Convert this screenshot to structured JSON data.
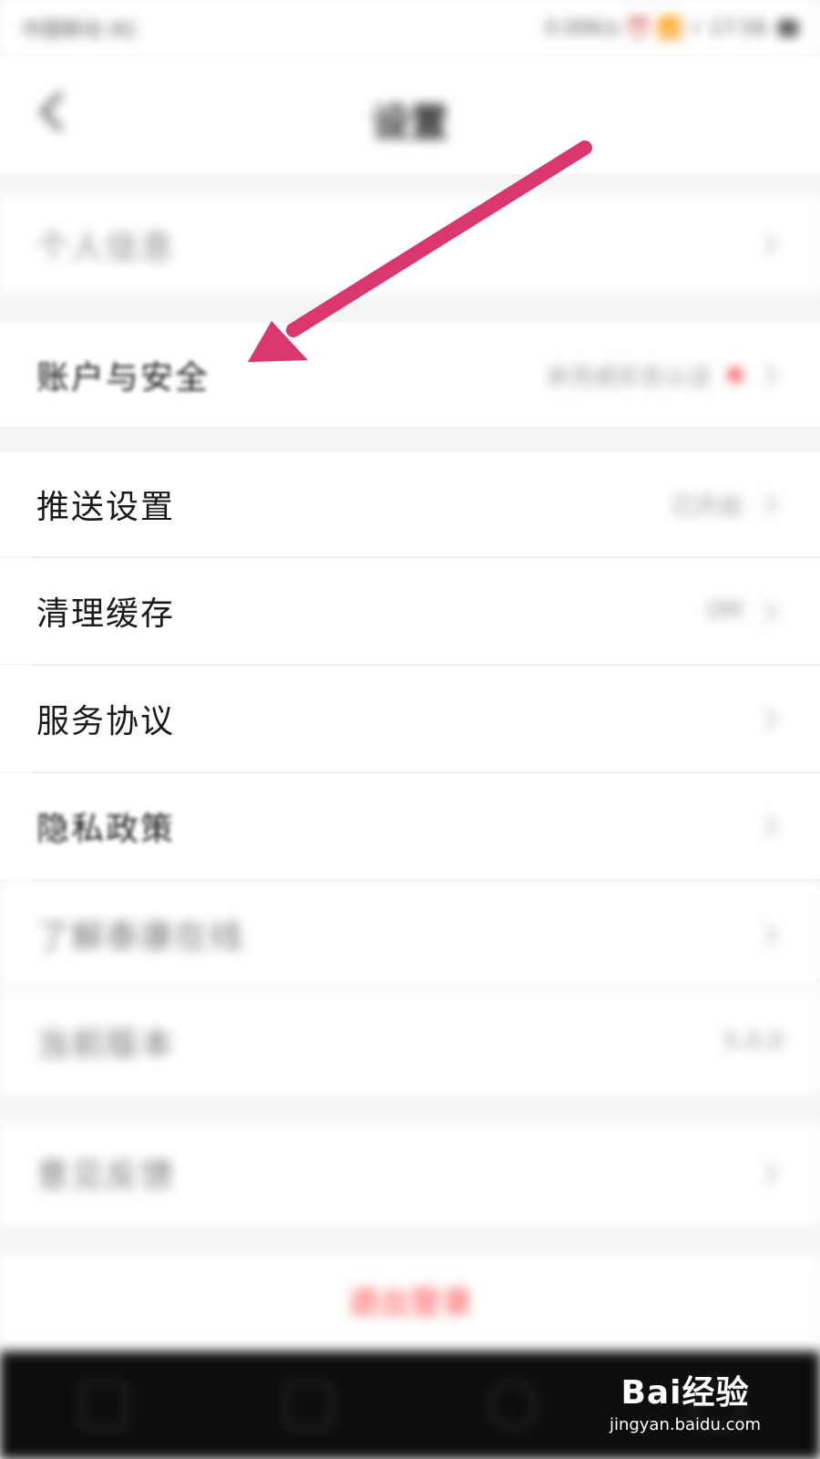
{
  "status_bar": {
    "left": "中国移动 4G",
    "right": "0.00K/s ⏰ 📶 ⚡ 17:56"
  },
  "nav": {
    "title": "设置"
  },
  "settings": [
    {
      "id": "personal",
      "label": "个人信息",
      "value": "",
      "dot": false
    },
    {
      "id": "account",
      "label": "账户与安全",
      "value": "未完成实名认证",
      "dot": true
    },
    {
      "id": "push",
      "label": "推送设置",
      "value": "已开启",
      "dot": false
    },
    {
      "id": "cache",
      "label": "清理缓存",
      "value": "0M",
      "dot": false
    },
    {
      "id": "service",
      "label": "服务协议",
      "value": "",
      "dot": false
    },
    {
      "id": "privacy",
      "label": "隐私政策",
      "value": "",
      "dot": false
    },
    {
      "id": "about",
      "label": "了解泰康在线",
      "value": "",
      "dot": false
    },
    {
      "id": "version",
      "label": "当前版本",
      "value": "5.0.0",
      "dot": false
    },
    {
      "id": "feedback",
      "label": "意见反馈",
      "value": "",
      "dot": false
    }
  ],
  "logout_label": "退出登录",
  "watermark": {
    "logo": "Bai经验",
    "url": "jingyan.baidu.com"
  },
  "colors": {
    "arrow": "#d9376e",
    "logout": "#ff3b3b",
    "dot": "#ff4d4f"
  }
}
